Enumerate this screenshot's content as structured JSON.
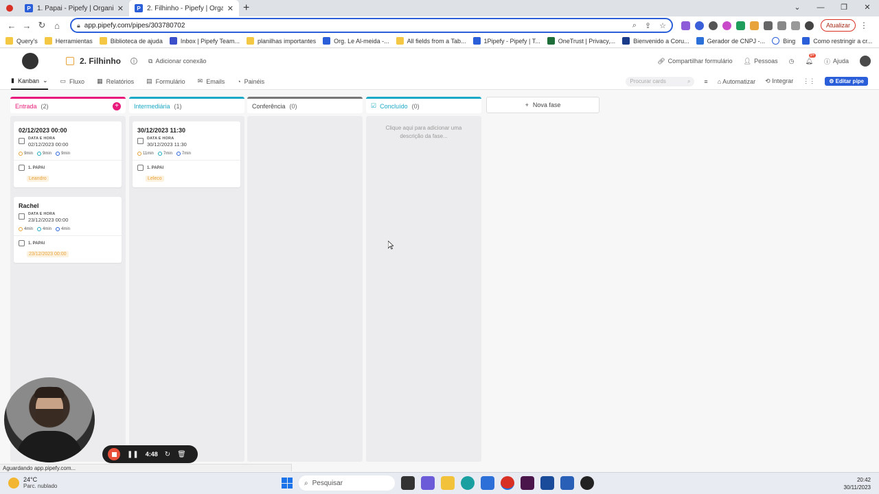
{
  "browser": {
    "tabs": [
      {
        "label": "1. Papai - Pipefy | Organizar os p",
        "favicon": "P",
        "active": false
      },
      {
        "label": "2. Filhinho - Pipefy | Organizar o",
        "favicon": "P",
        "active": true
      }
    ],
    "url": "app.pipefy.com/pipes/303780702",
    "update_label": "Atualizar",
    "bookmarks": [
      {
        "label": "Query's",
        "icon": "folder"
      },
      {
        "label": "Herramientas",
        "icon": "folder"
      },
      {
        "label": "Biblioteca de ajuda",
        "icon": "folder"
      },
      {
        "label": "Inbox | Pipefy Team...",
        "icon": "inbox-favicon"
      },
      {
        "label": "planilhas importantes",
        "icon": "folder"
      },
      {
        "label": "Org. Le Al-meida -...",
        "icon": "pipefy-favicon"
      },
      {
        "label": "All fields from a Tab...",
        "icon": "folder"
      },
      {
        "label": "1Pipefy - Pipefy | T...",
        "icon": "pipefy-favicon"
      },
      {
        "label": "OneTrust | Privacy,...",
        "icon": "onetrust-favicon"
      },
      {
        "label": "Bienvenido a Coru...",
        "icon": "coru-favicon"
      },
      {
        "label": "Gerador de CNPJ -...",
        "icon": "nv-favicon"
      },
      {
        "label": "Bing",
        "icon": "search-favicon"
      },
      {
        "label": "Como restringir a cr...",
        "icon": "pipefy-favicon"
      }
    ],
    "status_text": "Aguardando app.pipefy.com..."
  },
  "header": {
    "pipe_name": "2. Filhinho",
    "add_connection": "Adicionar conexão",
    "share_form": "Compartilhar formulário",
    "people": "Pessoas",
    "notifications_badge": "9+",
    "help": "Ajuda"
  },
  "subnav": {
    "tabs": [
      "Kanban",
      "Fluxo",
      "Relatórios",
      "Formulário",
      "Emails",
      "Painéis"
    ],
    "search_placeholder": "Procurar cards",
    "automate": "Automatizar",
    "integrate": "Integrar",
    "edit_pipe": "Editar pipe"
  },
  "phases": [
    {
      "name": "Entrada",
      "count": "(2)",
      "color": "#e8197a",
      "cards": [
        {
          "title": "02/12/2023 00:00",
          "field_label": "DATA E HORA",
          "field_value": "02/12/2023 00:00",
          "timers": [
            "9min",
            "9min",
            "9min"
          ],
          "connection_label": "1. PAPAI",
          "connection_value": "Leandro"
        },
        {
          "title": "Rachel",
          "field_label": "DATA E HORA",
          "field_value": "23/12/2023 00:00",
          "timers": [
            "4min",
            "4min",
            "4min"
          ],
          "connection_label": "1. PAPAI",
          "connection_value": "23/12/2023 00:00"
        }
      ]
    },
    {
      "name": "Intermediária",
      "count": "(1)",
      "color": "#1aa9c6",
      "cards": [
        {
          "title": "30/12/2023 11:30",
          "field_label": "DATA E HORA",
          "field_value": "30/12/2023 11:30",
          "timers": [
            "11min",
            "7min",
            "7min"
          ],
          "connection_label": "1. PAPAI",
          "connection_value": "Leleco"
        }
      ]
    },
    {
      "name": "Conferência",
      "count": "(0)",
      "color": "#777777",
      "cards": []
    },
    {
      "name": "Concluído",
      "count": "(0)",
      "color": "#1aa9c6",
      "description": "Clique aqui para adicionar uma descrição da fase...",
      "cards": []
    }
  ],
  "new_phase": "Nova fase",
  "recorder": {
    "time": "4:48"
  },
  "taskbar": {
    "temperature": "24°C",
    "weather": "Parc. nublado",
    "search": "Pesquisar",
    "time": "20:42",
    "date": "30/11/2023"
  }
}
